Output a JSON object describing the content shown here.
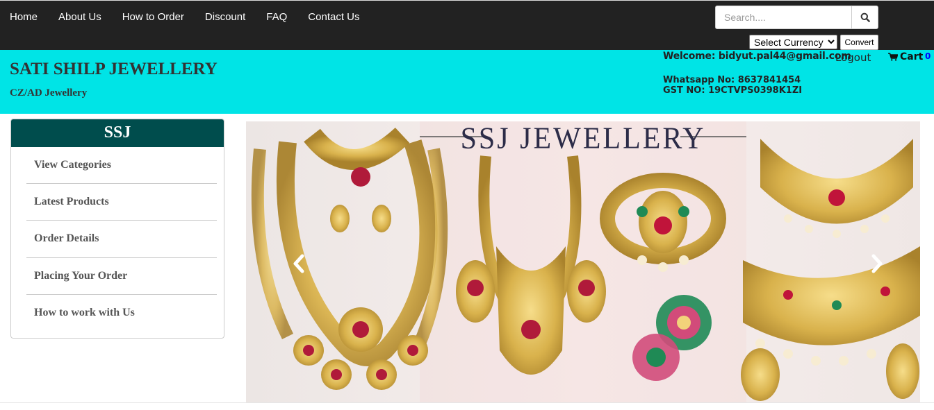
{
  "nav": {
    "items": [
      "Home",
      "About Us",
      "How to Order",
      "Discount",
      "FAQ",
      "Contact Us"
    ]
  },
  "search": {
    "placeholder": "Search....",
    "icon": "search-icon"
  },
  "currency": {
    "selected": "Select Currency",
    "convert_label": "Convert"
  },
  "header": {
    "brand": "SATI SHILP JEWELLERY",
    "tagline": "CZ/AD Jewellery",
    "welcome": "Welcome: bidyut.pal44@gmail.com",
    "logout": "Logout",
    "cart_label": "Cart",
    "cart_count": "0",
    "whatsapp": "Whatsapp No: 8637841454",
    "gst": "GST NO: 19CTVPS0398K1ZI"
  },
  "sidebar": {
    "title": "SSJ",
    "items": [
      {
        "label": "View Categories"
      },
      {
        "label": "Latest Products"
      },
      {
        "label": "Order Details"
      },
      {
        "label": "Placing Your Order"
      },
      {
        "label": "How to work with Us"
      }
    ]
  },
  "carousel": {
    "banner_title": "SSJ JEWELLERY",
    "prev_icon": "chevron-left-icon",
    "next_icon": "chevron-right-icon"
  },
  "colors": {
    "topbar": "#222222",
    "header": "#00e4e6",
    "sidebar_head": "#004d4d",
    "cart_count": "#0000ff"
  }
}
